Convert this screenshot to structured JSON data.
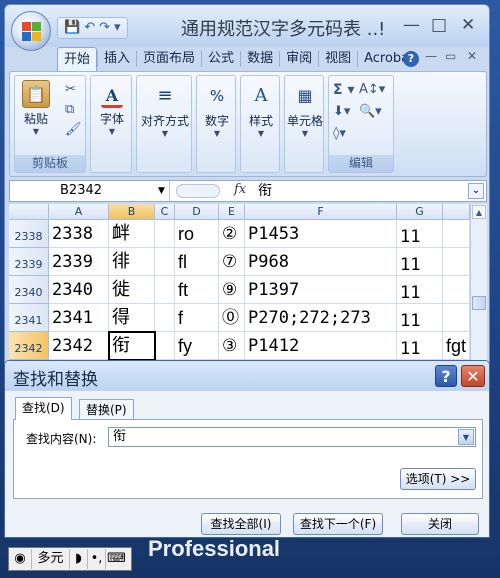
{
  "window": {
    "title": "通用规范汉字多元码表 ..!",
    "qat_save": "💾",
    "qat_undo": "↶",
    "qat_redo": "↷",
    "qat_more": "▾",
    "ctl_min": "—",
    "ctl_max": "□",
    "ctl_close": "✕"
  },
  "ribbon": {
    "tabs": [
      "开始",
      "插入",
      "页面布局",
      "公式",
      "数据",
      "审阅",
      "视图",
      "Acrobat"
    ],
    "help": "?",
    "mini_min": "—",
    "mini_restore": "▭",
    "mini_close": "✕",
    "groups": {
      "clipboard_label": "剪贴板",
      "paste": "粘贴",
      "font": "字体",
      "align": "对齐方式",
      "number": "数字",
      "style": "样式",
      "cells": "单元格",
      "edit_label": "编辑"
    }
  },
  "formula_bar": {
    "name_box": "B2342",
    "fx": "fx",
    "value": "衔"
  },
  "sheet": {
    "columns": [
      "A",
      "B",
      "C",
      "D",
      "E",
      "F",
      "G"
    ],
    "rows": [
      {
        "num": "2338",
        "a": "2338",
        "b": "衅",
        "c": "",
        "d": "ro",
        "e": "②",
        "f": "P1453",
        "g": "11",
        "h": ""
      },
      {
        "num": "2339",
        "a": "2339",
        "b": "徘",
        "c": "",
        "d": "fl",
        "e": "⑦",
        "f": "P968",
        "g": "11",
        "h": ""
      },
      {
        "num": "2340",
        "a": "2340",
        "b": "徙",
        "c": "",
        "d": "ft",
        "e": "⑨",
        "f": "P1397",
        "g": "11",
        "h": ""
      },
      {
        "num": "2341",
        "a": "2341",
        "b": "得",
        "c": "",
        "d": "f",
        "e": "⓪",
        "f": "P270;272;273",
        "g": "11",
        "h": ""
      },
      {
        "num": "2342",
        "a": "2342",
        "b": "衔",
        "c": "",
        "d": "fy",
        "e": "③",
        "f": "P1412",
        "g": "11",
        "h": "fgt"
      }
    ]
  },
  "dialog": {
    "title": "查找和替换",
    "help": "?",
    "close": "✕",
    "tab_find": "查找(D)",
    "tab_replace": "替换(P)",
    "find_label": "查找内容(N):",
    "find_value": "衔",
    "options": "选项(T) >>",
    "find_all": "查找全部(I)",
    "find_next": "查找下一个(F)",
    "close_btn": "关闭"
  },
  "desktop": {
    "brand": "Professional",
    "ime_lang": "多元"
  }
}
